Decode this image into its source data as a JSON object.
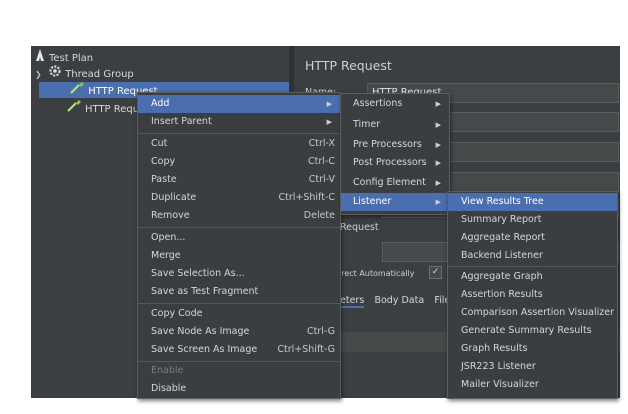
{
  "tree": {
    "test_plan": "Test Plan",
    "thread_group": "Thread Group",
    "http_request_1": "HTTP Request",
    "http_request_2": "HTTP Request"
  },
  "panel": {
    "title": "HTTP Request",
    "name_label": "Name:",
    "name_value": "HTTP Request",
    "request_label": "Request",
    "redirect_label": "edirect Automatically",
    "tabs": [
      "eters",
      "Body Data",
      "Files"
    ]
  },
  "context_menu": {
    "add": "Add",
    "insert_parent": "Insert Parent",
    "cut": "Cut",
    "cut_sc": "Ctrl-X",
    "copy": "Copy",
    "copy_sc": "Ctrl-C",
    "paste": "Paste",
    "paste_sc": "Ctrl-V",
    "duplicate": "Duplicate",
    "duplicate_sc": "Ctrl+Shift-C",
    "remove": "Remove",
    "remove_sc": "Delete",
    "open": "Open...",
    "merge": "Merge",
    "save_selection": "Save Selection As...",
    "save_fragment": "Save as Test Fragment",
    "copy_code": "Copy Code",
    "save_node_image": "Save Node As Image",
    "save_node_image_sc": "Ctrl-G",
    "save_screen_image": "Save Screen As Image",
    "save_screen_image_sc": "Ctrl+Shift-G",
    "enable": "Enable",
    "disable": "Disable"
  },
  "add_menu": {
    "assertions": "Assertions",
    "timer": "Timer",
    "pre_processors": "Pre Processors",
    "post_processors": "Post Processors",
    "config_element": "Config Element",
    "listener": "Listener"
  },
  "listener_menu": {
    "items": [
      "View Results Tree",
      "Summary Report",
      "Aggregate Report",
      "Backend Listener",
      "Aggregate Graph",
      "Assertion Results",
      "Comparison Assertion Visualizer",
      "Generate Summary Results",
      "Graph Results",
      "JSR223 Listener",
      "Mailer Visualizer"
    ]
  },
  "colors": {
    "accent": "#4b6eaf",
    "background": "#3c3f41",
    "menu": "#3b3e40"
  }
}
